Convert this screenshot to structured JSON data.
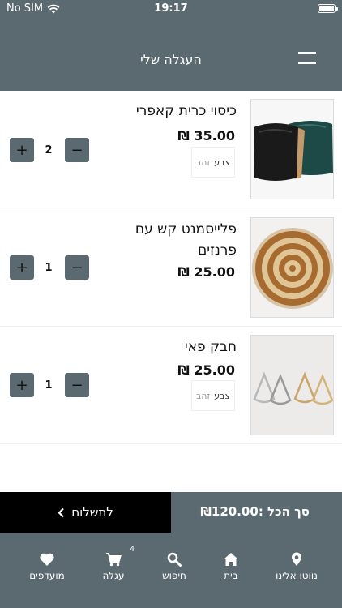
{
  "status": {
    "carrier": "No SIM",
    "time": "19:17"
  },
  "header": {
    "title": "העגלה שלי"
  },
  "items": [
    {
      "name": "כיסוי כרית קאפרי",
      "price": "₪ 35.00",
      "attr_label": "צבע",
      "attr_value": "זהב",
      "qty": "2"
    },
    {
      "name": "פלייסמנט קש עם פרנזים",
      "price": "₪ 25.00",
      "qty": "1"
    },
    {
      "name": "חבק פאי",
      "price": "₪ 25.00",
      "attr_label": "צבע",
      "attr_value": "זהב",
      "qty": "1"
    }
  ],
  "qty_buttons": {
    "plus": "+",
    "minus": "−"
  },
  "footer": {
    "checkout_label": "לתשלום",
    "total_label": "סך הכל :₪120.00"
  },
  "nav": {
    "contact": "נווטו אלינו",
    "home": "בית",
    "search": "חיפוש",
    "cart": "עגלה",
    "cart_badge": "4",
    "favorites": "מועדפים"
  },
  "colors": {
    "primary": "#5a6a70",
    "checkout": "#000000",
    "background": "#ffffff"
  }
}
